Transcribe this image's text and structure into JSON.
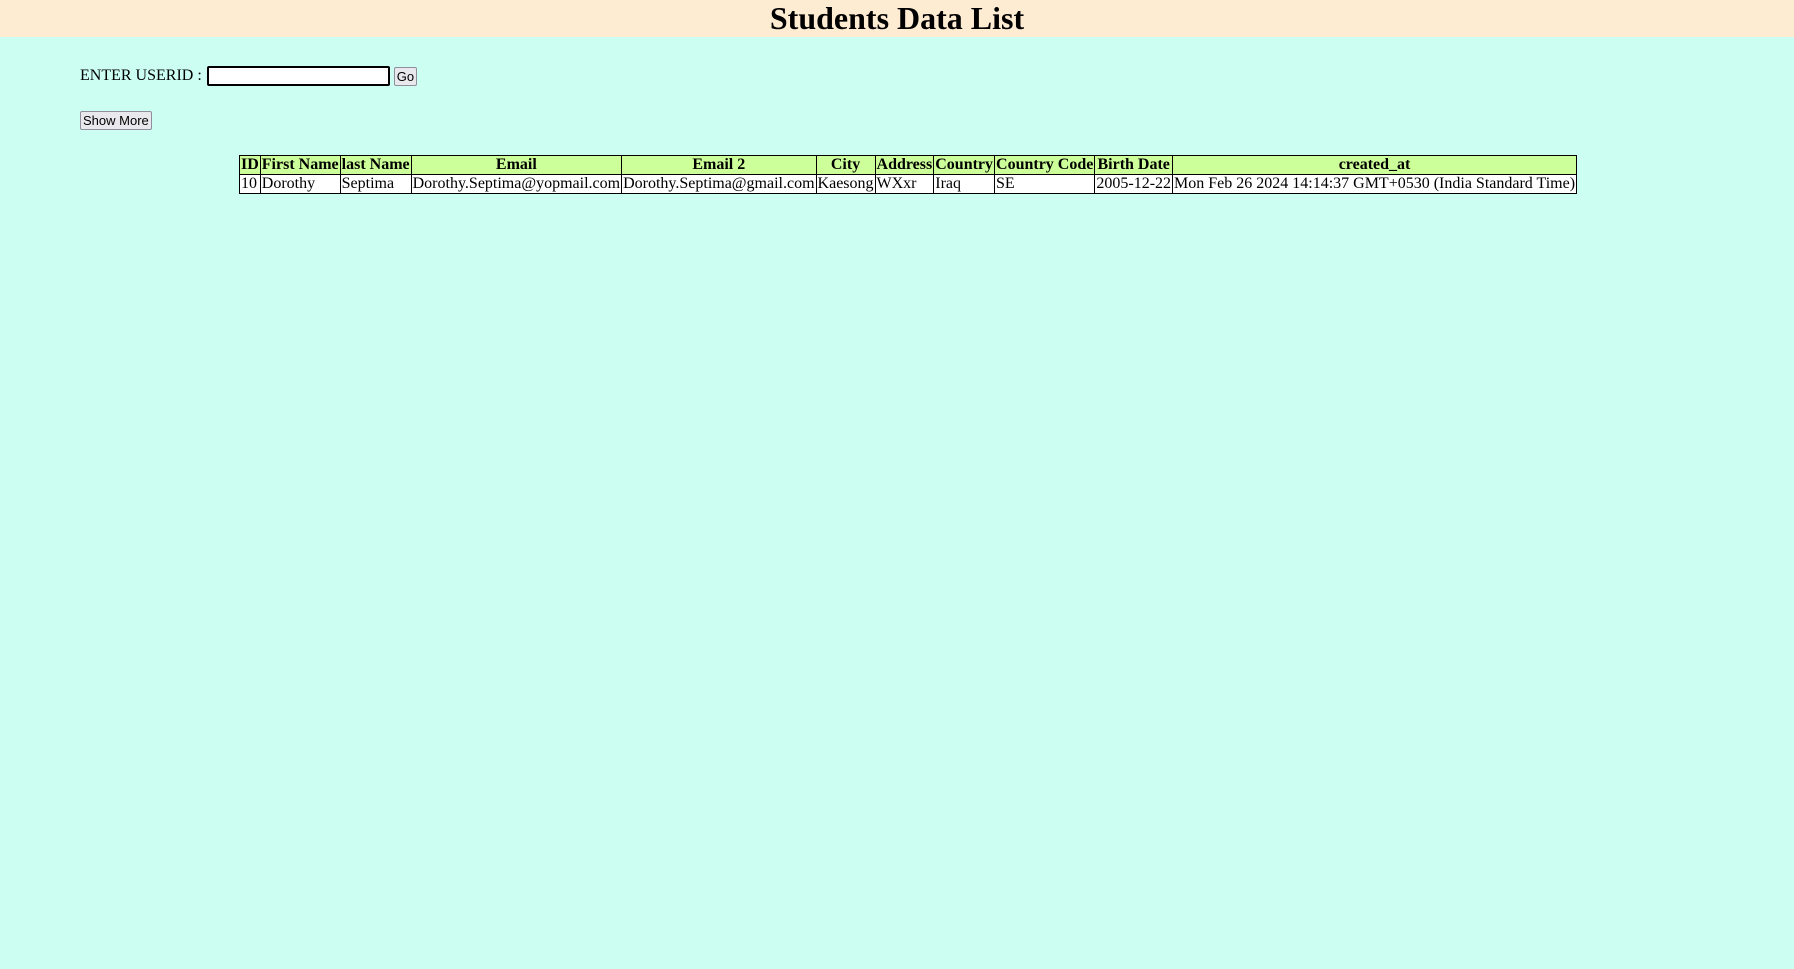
{
  "header": {
    "title": "Students Data List"
  },
  "search": {
    "label": "ENTER USERID :",
    "value": "",
    "placeholder": "",
    "go_label": "Go"
  },
  "show_more_label": "Show More",
  "table": {
    "columns": [
      "ID",
      "First Name",
      "last Name",
      "Email",
      "Email 2",
      "City",
      "Address",
      "Country",
      "Country Code",
      "Birth Date",
      "created_at"
    ],
    "rows": [
      [
        "10",
        "Dorothy",
        "Septima",
        "Dorothy.Septima@yopmail.com",
        "Dorothy.Septima@gmail.com",
        "Kaesong",
        "WXxr",
        "Iraq",
        "SE",
        "2005-12-22",
        "Mon Feb 26 2024 14:14:37 GMT+0530 (India Standard Time)"
      ]
    ]
  },
  "colors": {
    "page_background": "#ccfff2",
    "header_background": "#fdebd2",
    "table_header_background": "#ccff99",
    "table_cell_background": "#ffffff"
  }
}
